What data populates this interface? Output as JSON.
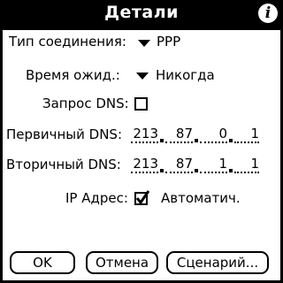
{
  "dialog": {
    "title": "Детали",
    "info_icon": "info-icon"
  },
  "connection": {
    "label": "Тип соединения:",
    "value": "PPP"
  },
  "idle": {
    "label": "Время ожид.:",
    "value": "Никогда"
  },
  "dns_query": {
    "label": "Запрос DNS:",
    "checked": false
  },
  "primary_dns": {
    "label": "Первичный DNS:",
    "octets": [
      "213",
      "87",
      "0",
      "1"
    ]
  },
  "secondary_dns": {
    "label": "Вторичный DNS:",
    "octets": [
      "213",
      "87",
      "1",
      "1"
    ]
  },
  "ip_address": {
    "label": "IP Адрес:",
    "checked": true,
    "value": "Автоматич."
  },
  "buttons": {
    "ok": "OK",
    "cancel": "Отмена",
    "script": "Сценарий..."
  }
}
